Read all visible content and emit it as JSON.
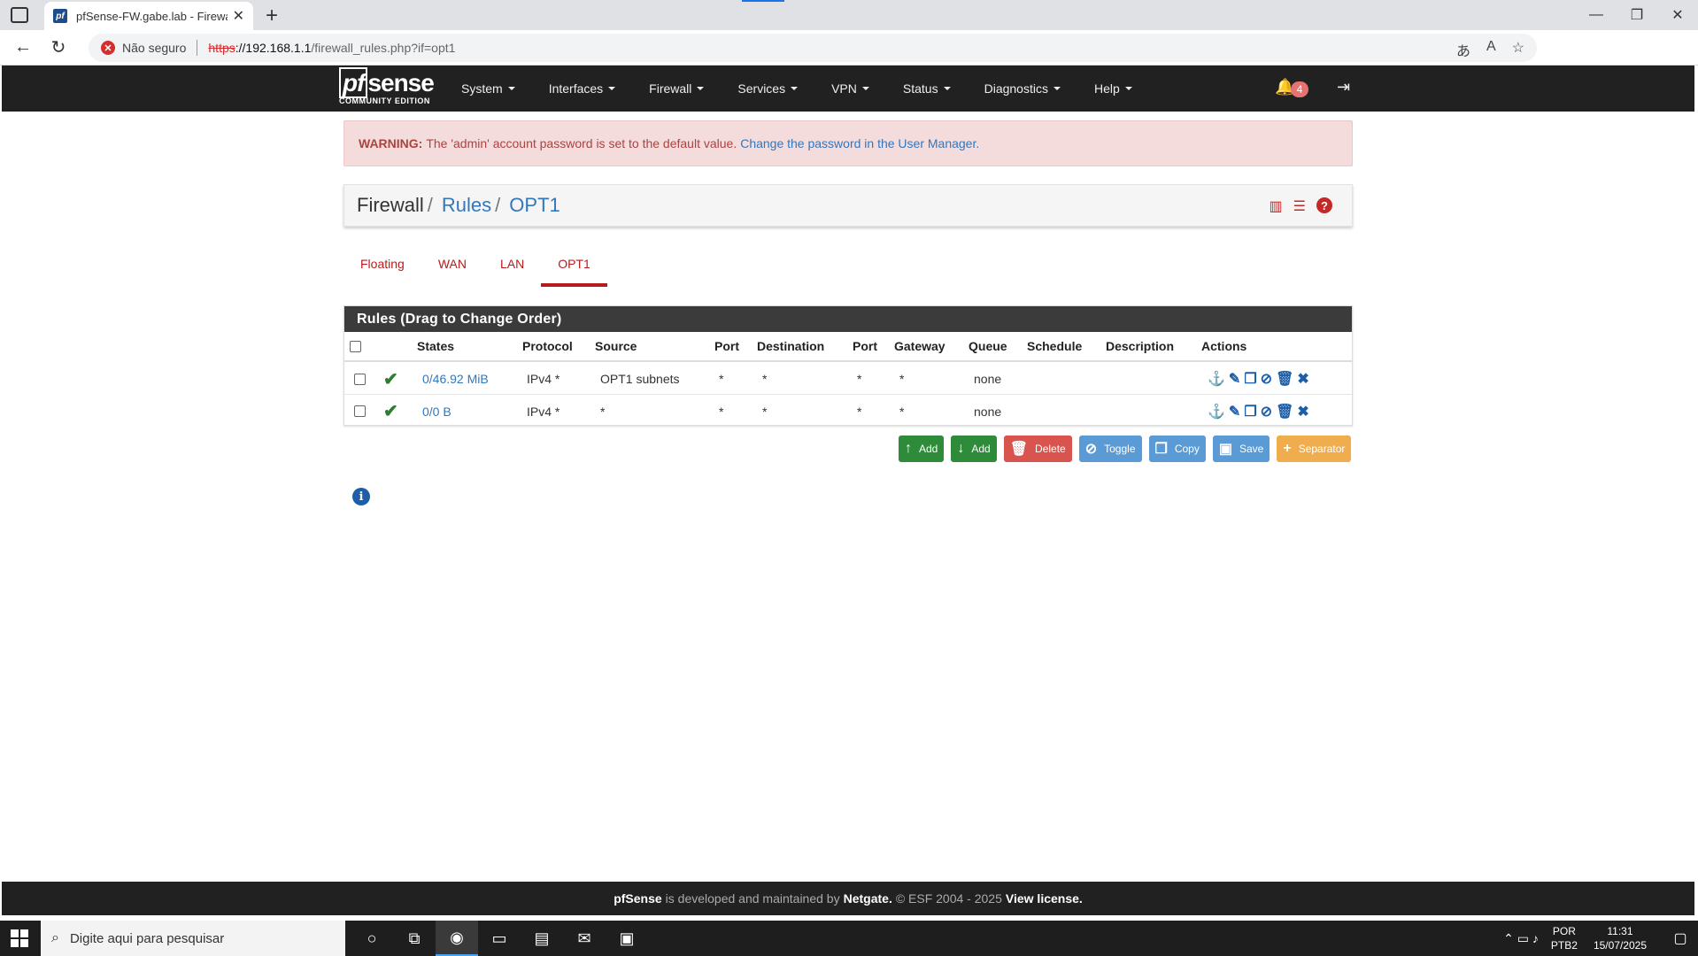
{
  "browser": {
    "tab_title": "pfSense-FW.gabe.lab - Firewall: R",
    "favicon_text": "pf",
    "not_secure": "Não seguro",
    "url_https": "https",
    "url_host": "://192.168.1.1",
    "url_path": "/firewall_rules.php?if=opt1"
  },
  "navbar": {
    "logo_word": "sense",
    "logo_pf": "pf",
    "logo_sub": "COMMUNITY EDITION",
    "menu": [
      "System",
      "Interfaces",
      "Firewall",
      "Services",
      "VPN",
      "Status",
      "Diagnostics",
      "Help"
    ],
    "notification_count": "4"
  },
  "warning": {
    "label": "WARNING:",
    "text": "The 'admin' account password is set to the default value.",
    "link": "Change the password in the User Manager."
  },
  "breadcrumb": {
    "root": "Firewall",
    "sep": "/",
    "rules": "Rules",
    "current": "OPT1"
  },
  "tabs": [
    "Floating",
    "WAN",
    "LAN",
    "OPT1"
  ],
  "active_tab": "OPT1",
  "rules": {
    "heading": "Rules (Drag to Change Order)",
    "columns": [
      "States",
      "Protocol",
      "Source",
      "Port",
      "Destination",
      "Port",
      "Gateway",
      "Queue",
      "Schedule",
      "Description",
      "Actions"
    ],
    "rows": [
      {
        "states": "0/46.92 MiB",
        "protocol": "IPv4 *",
        "source": "OPT1 subnets",
        "src_port": "*",
        "destination": "*",
        "dst_port": "*",
        "gateway": "*",
        "queue": "none",
        "schedule": "",
        "description": ""
      },
      {
        "states": "0/0 B",
        "protocol": "IPv4 *",
        "source": "*",
        "src_port": "*",
        "destination": "*",
        "dst_port": "*",
        "gateway": "*",
        "queue": "none",
        "schedule": "",
        "description": ""
      }
    ]
  },
  "buttons": {
    "add_top": "Add",
    "add_bottom": "Add",
    "delete": "Delete",
    "toggle": "Toggle",
    "copy": "Copy",
    "save": "Save",
    "separator": "Separator"
  },
  "footer": {
    "brand": "pfSense",
    "text1": "is developed and maintained by",
    "company": "Netgate.",
    "text2": "© ESF 2004 - 2025",
    "license": "View license."
  },
  "taskbar": {
    "search_placeholder": "Digite aqui para pesquisar",
    "lang1": "POR",
    "lang2": "PTB2",
    "time": "11:31",
    "date": "15/07/2025"
  },
  "colors": {
    "navbar": "#212121",
    "accent_red": "#b71c1c",
    "link_blue": "#3377bb",
    "green": "#2e8b3a"
  }
}
